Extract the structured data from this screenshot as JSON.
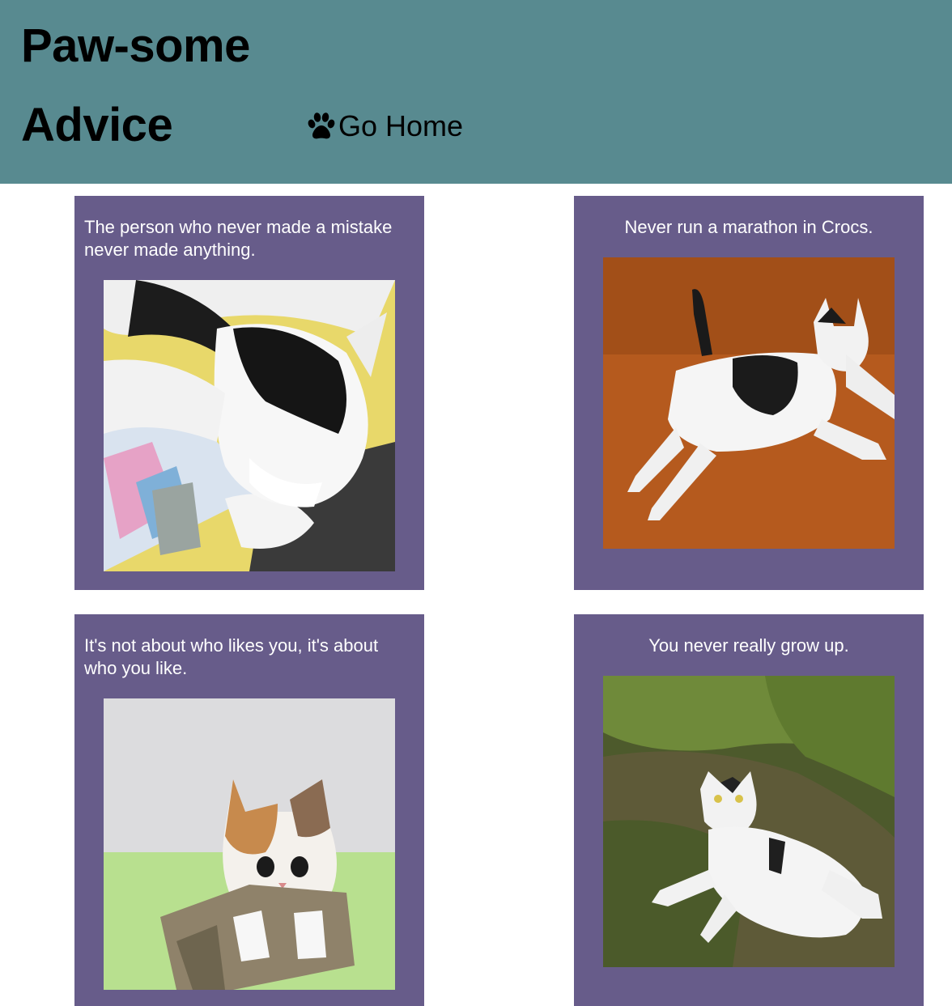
{
  "header": {
    "title": "Paw-some Advice",
    "home_link": {
      "icon": "paw-icon",
      "label": "Go Home"
    }
  },
  "colors": {
    "header_bg": "#588a90",
    "card_bg": "#675c8a",
    "card_text": "#ffffff"
  },
  "cards": [
    {
      "quote": "The person who never made a mistake never made anything.",
      "photo": "black and white cat sleeping on a colorful blanket"
    },
    {
      "quote": "Never run a marathon in Crocs.",
      "photo": "black and white cat lying on a cork floor"
    },
    {
      "quote": "It's not about who likes you, it's about who you like.",
      "photo": "calico kitten in a cardboard box"
    },
    {
      "quote": "You never really grow up.",
      "photo": "white cat lying on grass"
    }
  ]
}
